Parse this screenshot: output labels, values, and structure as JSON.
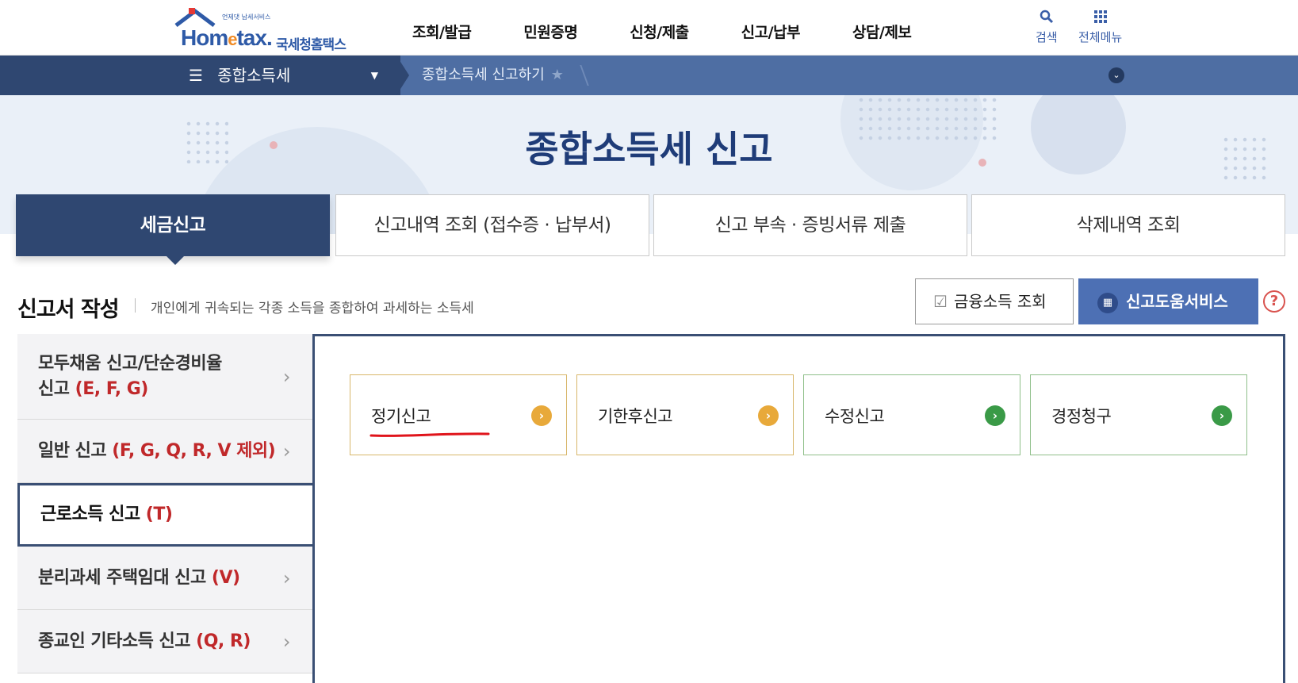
{
  "header": {
    "logo_tagline": "언제댓 납세서비스",
    "logo_brand_pre": "Hom",
    "logo_brand_e": "e",
    "logo_brand_post": "tax.",
    "logo_korean": "국세청홈택스",
    "nav": [
      "조회/발급",
      "민원증명",
      "신청/제출",
      "신고/납부",
      "상담/제보"
    ],
    "search_label": "검색",
    "allmenu_label": "전체메뉴",
    "search_icon": "search-icon",
    "allmenu_icon": "grid-icon"
  },
  "strip": {
    "current_menu": "종합소득세",
    "breadcrumb": "종합소득세 신고하기"
  },
  "hero": {
    "title": "종합소득세  신고"
  },
  "tabs": [
    {
      "label": "세금신고",
      "active": true
    },
    {
      "label": "신고내역 조회 (접수증 · 납부서)",
      "active": false
    },
    {
      "label": "신고 부속 · 증빙서류 제출",
      "active": false
    },
    {
      "label": "삭제내역 조회",
      "active": false
    }
  ],
  "section": {
    "title": "신고서 작성",
    "description": "개인에게 귀속되는 각종 소득을 종합하여 과세하는 소득세",
    "financial_button": "금융소득 조회",
    "help_button": "신고도움서비스",
    "help_mark": "?"
  },
  "left_menu": [
    {
      "line1": "모두채움 신고/단순경비율",
      "line2": "신고 ",
      "code": "(E, F, G)",
      "active": false
    },
    {
      "label": "일반 신고 ",
      "code": "(F, G, Q, R, V 제외)",
      "active": false
    },
    {
      "label": "근로소득 신고 ",
      "code": "(T)",
      "active": true
    },
    {
      "label": "분리과세 주택임대 신고 ",
      "code": "(V)",
      "active": false
    },
    {
      "label": "종교인 기타소득 신고 ",
      "code": "(Q, R)",
      "active": false
    }
  ],
  "cards": [
    {
      "label": "정기신고",
      "color": "#e8a93a",
      "annotated": true
    },
    {
      "label": "기한후신고",
      "color": "#e8a93a",
      "annotated": false
    },
    {
      "label": "수정신고",
      "color": "#3a9a47",
      "annotated": false
    },
    {
      "label": "경정청구",
      "color": "#3a9a47",
      "annotated": false
    }
  ],
  "colors": {
    "navy": "#2f4771",
    "brand_blue": "#2e5aa7",
    "accent_red": "#c0282a",
    "annotation_red": "#e0141b"
  }
}
